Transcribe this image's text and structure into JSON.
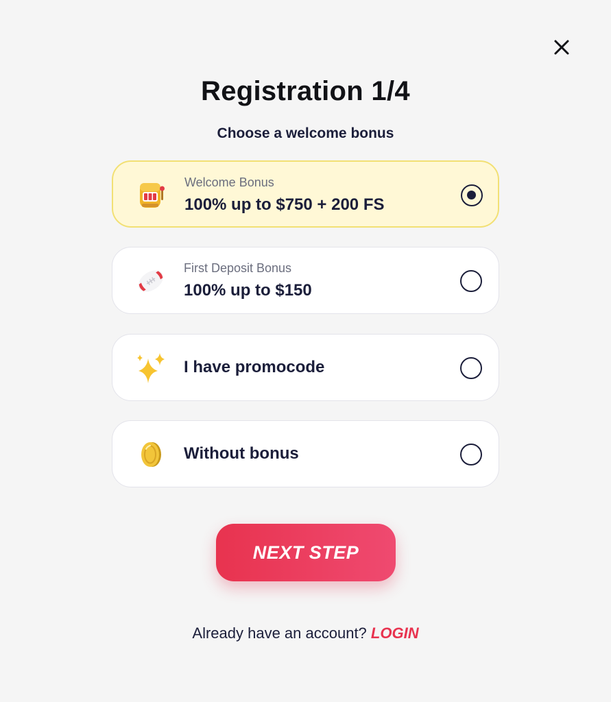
{
  "dialog": {
    "title": "Registration 1/4",
    "subtitle": "Choose a welcome bonus",
    "close_icon": "close-icon"
  },
  "options": [
    {
      "icon": "slot-machine-icon",
      "caption": "Welcome Bonus",
      "value": "100% up to $750 + 200 FS",
      "selected": true
    },
    {
      "icon": "football-icon",
      "caption": "First Deposit Bonus",
      "value": "100% up to $150",
      "selected": false
    },
    {
      "icon": "sparkles-icon",
      "label": "I have promocode",
      "selected": false
    },
    {
      "icon": "coin-icon",
      "label": "Without bonus",
      "selected": false
    }
  ],
  "next_button": {
    "label": "NEXT STEP"
  },
  "footer": {
    "question": "Already have an account?",
    "login_label": "LOGIN"
  },
  "colors": {
    "accent": "#e8334f",
    "selected_background": "#fff8d6",
    "selected_border": "#f2e074",
    "text_dark": "#1b1e3a"
  }
}
